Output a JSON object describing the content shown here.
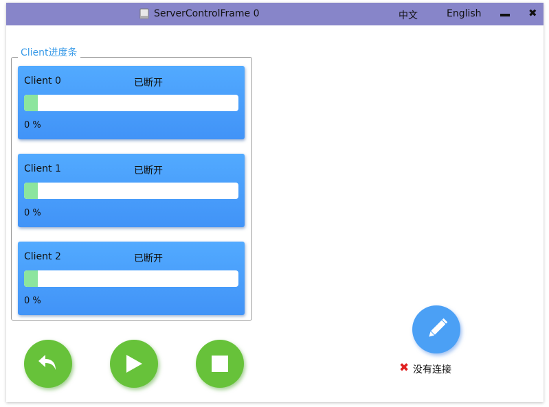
{
  "window": {
    "title": "ServerControlFrame 0",
    "lang_zh": "中文",
    "lang_en": "English",
    "minimize_icon": "minimize-icon",
    "close_icon": "close-icon",
    "titlebar_color": "#8785c9"
  },
  "group": {
    "legend": "Client进度条"
  },
  "clients": [
    {
      "name": "Client 0",
      "status": "已断开",
      "percent_text": "0 %",
      "progress": 0
    },
    {
      "name": "Client 1",
      "status": "已断开",
      "percent_text": "0 %",
      "progress": 0
    },
    {
      "name": "Client 2",
      "status": "已断开",
      "percent_text": "0 %",
      "progress": 0
    }
  ],
  "controls": {
    "back_icon": "reply-icon",
    "play_icon": "play-icon",
    "stop_icon": "stop-icon",
    "edit_icon": "pencil-icon",
    "green": "#67c23a",
    "blue": "#4ba0f5"
  },
  "connection": {
    "icon": "red-x-icon",
    "text": "没有连接",
    "icon_color": "#e02020"
  }
}
